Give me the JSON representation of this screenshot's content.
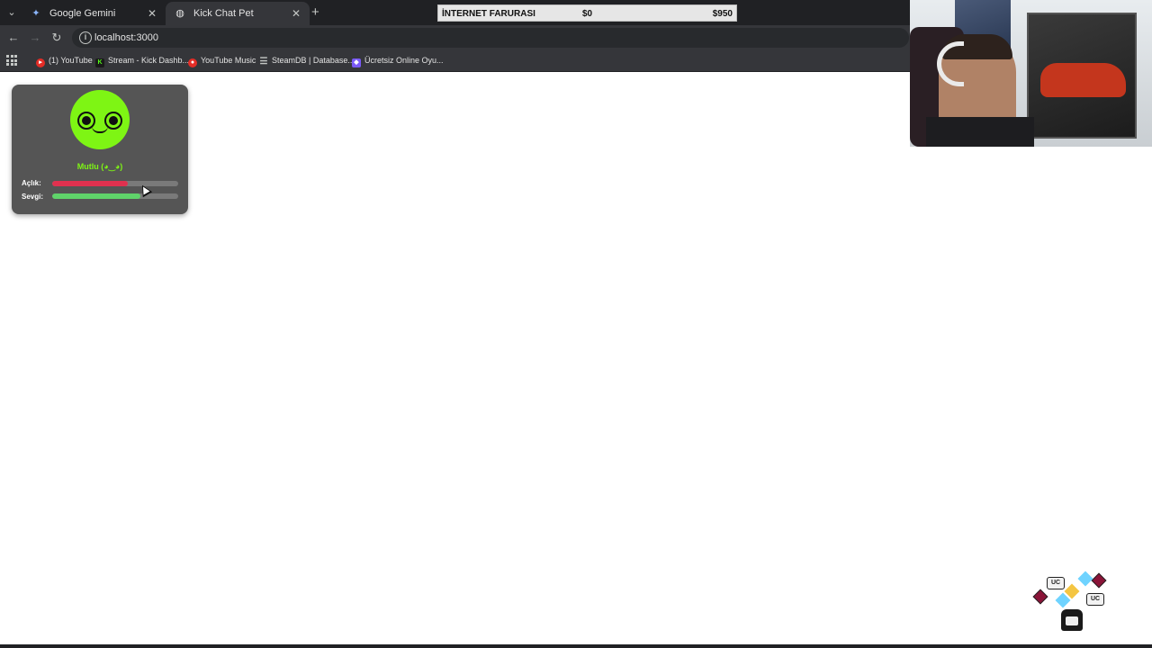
{
  "browser": {
    "tabs": [
      {
        "label": "Google Gemini",
        "active": false
      },
      {
        "label": "Kick Chat Pet",
        "active": true
      }
    ],
    "url": "localhost:3000",
    "bookmarks": [
      {
        "label": "(1) YouTube",
        "color": "#e52d27"
      },
      {
        "label": "Stream - Kick Dashb...",
        "color": "#53fc18"
      },
      {
        "label": "YouTube Music",
        "color": "#e52d27"
      },
      {
        "label": "SteamDB | Database...",
        "color": "#c4c7c5"
      },
      {
        "label": "Ücretsiz Online Oyu...",
        "color": "#7a5af8"
      }
    ]
  },
  "overlay_bar": {
    "title": "İNTERNET FARURASI",
    "current": "$0",
    "goal": "$950"
  },
  "pet": {
    "mood": "Mutlu (◕‿◕)",
    "face_color": "#7ef514",
    "stats": [
      {
        "label": "Açlık:",
        "value": 0.6,
        "color": "#e0314f"
      },
      {
        "label": "Sevgi:",
        "value": 0.7,
        "color": "#5fd36a"
      }
    ]
  },
  "webcam": {
    "icon": "webcam-feed"
  },
  "overlay_icons": {
    "badge_text": "UC"
  }
}
